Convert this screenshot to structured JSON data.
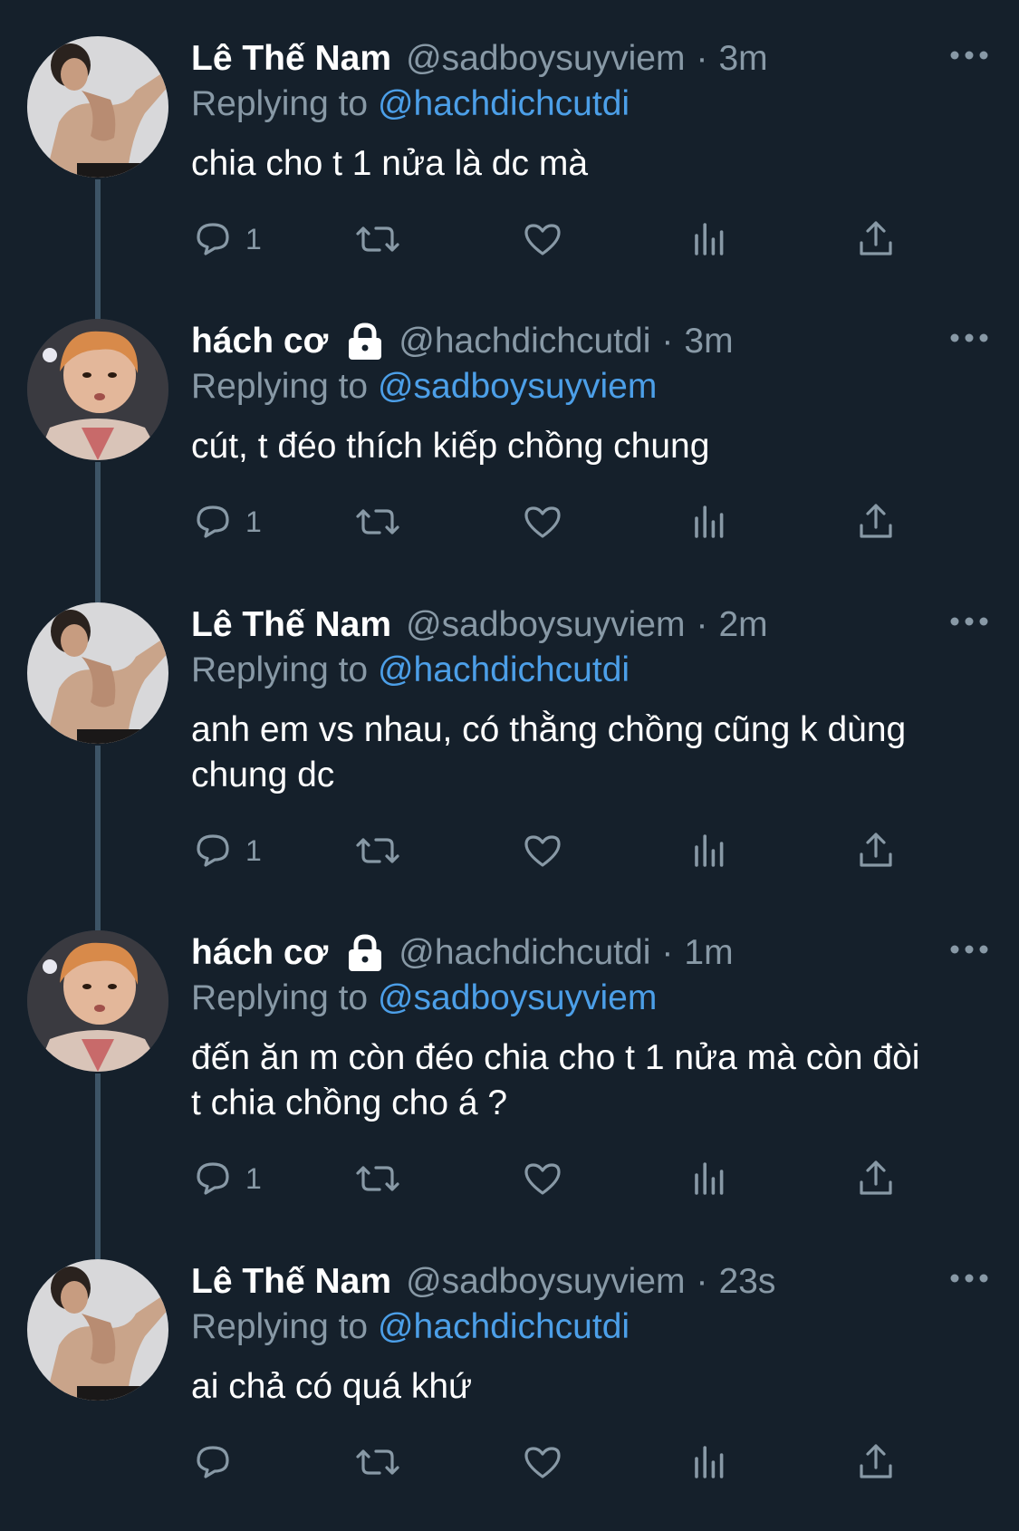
{
  "theme": {
    "background": "#15202b",
    "text": "#ffffff",
    "muted": "#8899a6",
    "link": "#4c9fe8",
    "thread_line": "#3d5466"
  },
  "tweets": [
    {
      "name": "Lê Thế Nam",
      "protected": false,
      "handle": "@sadboysuyviem",
      "dot": "·",
      "time": "3m",
      "replying_prefix": "Replying to",
      "replying_to": "@hachdichcutdi",
      "text": "chia cho t 1 nửa là dc mà",
      "reply_count": "1",
      "avatar_icon": "shirtless-man-avatar"
    },
    {
      "name": "hách cơ",
      "protected": true,
      "handle": "@hachdichcutdi",
      "dot": "·",
      "time": "3m",
      "replying_prefix": "Replying to",
      "replying_to": "@sadboysuyviem",
      "text": "cút, t đéo thích kiếp chồng chung",
      "reply_count": "1",
      "avatar_icon": "orange-hair-man-avatar"
    },
    {
      "name": "Lê Thế Nam",
      "protected": false,
      "handle": "@sadboysuyviem",
      "dot": "·",
      "time": "2m",
      "replying_prefix": "Replying to",
      "replying_to": "@hachdichcutdi",
      "text": "anh em vs nhau, có thằng chồng cũng k dùng chung dc",
      "reply_count": "1",
      "avatar_icon": "shirtless-man-avatar"
    },
    {
      "name": "hách cơ",
      "protected": true,
      "handle": "@hachdichcutdi",
      "dot": "·",
      "time": "1m",
      "replying_prefix": "Replying to",
      "replying_to": "@sadboysuyviem",
      "text": "đến ăn m còn đéo chia cho t 1 nửa mà còn đòi t chia chồng cho á ?",
      "reply_count": "1",
      "avatar_icon": "orange-hair-man-avatar"
    },
    {
      "name": "Lê Thế Nam",
      "protected": false,
      "handle": "@sadboysuyviem",
      "dot": "·",
      "time": "23s",
      "replying_prefix": "Replying to",
      "replying_to": "@hachdichcutdi",
      "text": "ai chả có quá khứ",
      "reply_count": "",
      "avatar_icon": "shirtless-man-avatar"
    }
  ],
  "action_icons": [
    "reply-icon",
    "retweet-icon",
    "like-icon",
    "analytics-icon",
    "share-icon"
  ],
  "more_icon": "more-options-icon",
  "lock_icon": "lock-icon"
}
